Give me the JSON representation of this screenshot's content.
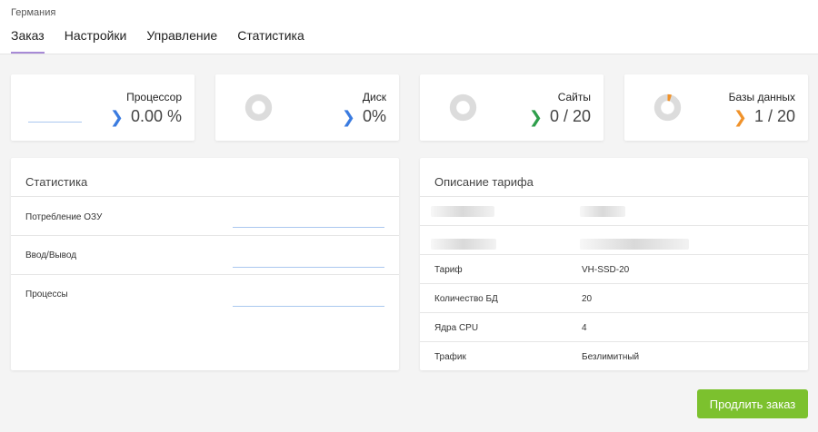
{
  "header": {
    "region": "Германия",
    "tabs": [
      {
        "label": "Заказ",
        "active": true
      },
      {
        "label": "Настройки"
      },
      {
        "label": "Управление"
      },
      {
        "label": "Статистика"
      }
    ]
  },
  "metrics": [
    {
      "label": "Процессор",
      "value": "0.00 %",
      "icon": "chevron-right-icon",
      "color": "#3a7be0"
    },
    {
      "label": "Диск",
      "value": "0%",
      "icon": "chevron-right-icon",
      "color": "#3a7be0"
    },
    {
      "label": "Сайты",
      "value": "0 / 20",
      "icon": "chevron-right-icon",
      "color": "#2e9e4b"
    },
    {
      "label": "Базы данных",
      "value": "1 / 20",
      "icon": "chevron-right-icon",
      "color": "#f0922a"
    }
  ],
  "statistics": {
    "title": "Статистика",
    "rows": [
      {
        "label": "Потребление ОЗУ"
      },
      {
        "label": "Ввод/Вывод"
      },
      {
        "label": "Процессы"
      }
    ]
  },
  "tariff": {
    "title": "Описание тарифа",
    "rows": [
      {
        "label": "Тариф",
        "value": "VH-SSD-20"
      },
      {
        "label": "Количество БД",
        "value": "20"
      },
      {
        "label": "Ядра CPU",
        "value": "4"
      },
      {
        "label": "Трафик",
        "value": "Безлимитный"
      }
    ]
  },
  "actions": {
    "renew_label": "Продлить заказ",
    "renew_color": "#7cc12e"
  }
}
